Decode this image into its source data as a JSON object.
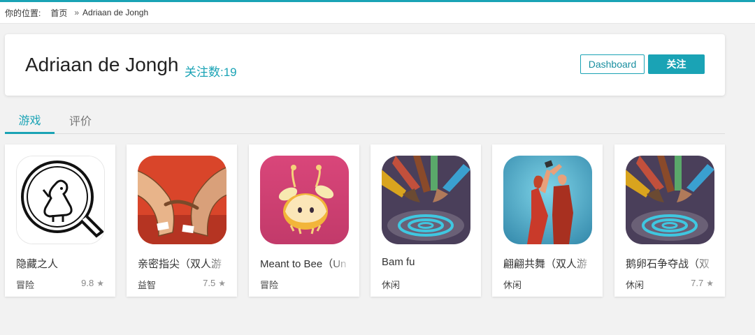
{
  "breadcrumb": {
    "label": "你的位置:",
    "home": "首页",
    "separator": "»",
    "current": "Adriaan de Jongh"
  },
  "header": {
    "developer_name": "Adriaan de Jongh",
    "follow_count": "关注数:19",
    "dashboard_button": "Dashboard",
    "follow_button": "关注"
  },
  "tabs": [
    {
      "label": "游戏",
      "active": true
    },
    {
      "label": "评价",
      "active": false
    }
  ],
  "colors": {
    "accent": "#1aa3b5"
  },
  "games": [
    {
      "title": "隐藏之人",
      "category": "冒险",
      "rating": "9.8",
      "icon": "hidden-folks-icon"
    },
    {
      "title": "亲密指尖（双人游",
      "category": "益智",
      "rating": "7.5",
      "icon": "fingle-icon"
    },
    {
      "title": "Meant to Bee（Un",
      "category": "冒险",
      "rating": "",
      "icon": "meant-to-bee-icon"
    },
    {
      "title": "Bam fu",
      "category": "休闲",
      "rating": "",
      "icon": "bam-fu-icon"
    },
    {
      "title": "翩翩共舞（双人游",
      "category": "休闲",
      "rating": "",
      "icon": "dancing-couple-icon"
    },
    {
      "title": "鹅卵石争夺战（双",
      "category": "休闲",
      "rating": "7.7",
      "icon": "bam-fu-icon"
    }
  ]
}
